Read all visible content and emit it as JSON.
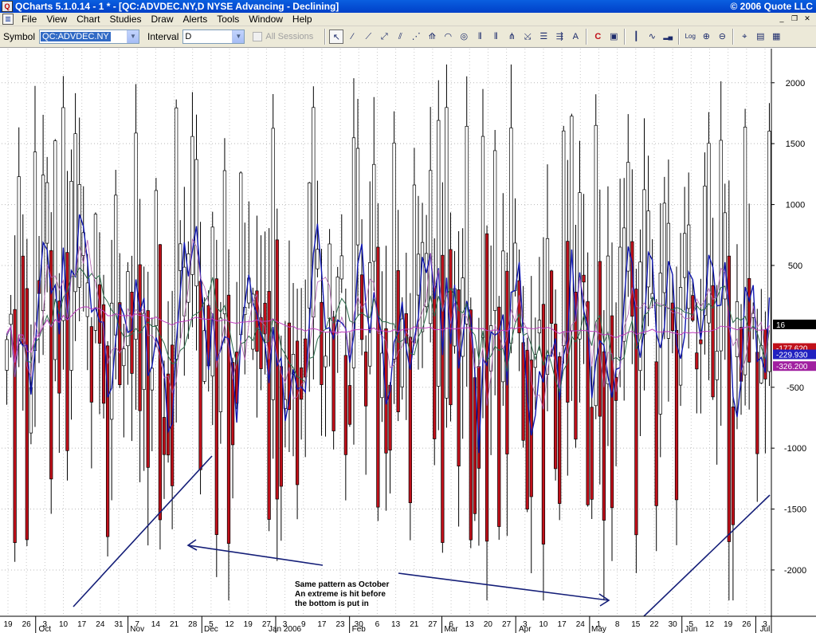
{
  "window": {
    "title": "QCharts 5.1.0.14 - 1 * - [QC:ADVDEC.NY,D NYSE Advancing - Declining]",
    "copyright": "© 2006 Quote LLC",
    "app_icon": "qcharts-logo-icon"
  },
  "menu": {
    "items": [
      "File",
      "View",
      "Chart",
      "Studies",
      "Draw",
      "Alerts",
      "Tools",
      "Window",
      "Help"
    ]
  },
  "toolbar": {
    "symbol_label": "Symbol",
    "symbol_value": "QC:ADVDEC.NY",
    "interval_label": "Interval",
    "interval_value": "D",
    "all_sessions_label": "All Sessions",
    "all_sessions_checked": false,
    "tools": [
      {
        "name": "pointer-icon",
        "glyph": "↖"
      },
      {
        "name": "trendline-icon",
        "glyph": "⁄"
      },
      {
        "name": "ray-icon",
        "glyph": "⟋"
      },
      {
        "name": "extended-line-icon",
        "glyph": "⤢"
      },
      {
        "name": "channel-icon",
        "glyph": "⫽"
      },
      {
        "name": "regression-icon",
        "glyph": "⋰"
      },
      {
        "name": "fan-icon",
        "glyph": "⟰"
      },
      {
        "name": "arc-icon",
        "glyph": "◠"
      },
      {
        "name": "ellipse-icon",
        "glyph": "◎"
      },
      {
        "name": "cycle-icon",
        "glyph": "⫴"
      },
      {
        "name": "fibonacci-time-icon",
        "glyph": "⦀"
      },
      {
        "name": "andrews-icon",
        "glyph": "⋔"
      },
      {
        "name": "gann-icon",
        "glyph": "⤩"
      },
      {
        "name": "retracement-icon",
        "glyph": "☰"
      },
      {
        "name": "speed-lines-icon",
        "glyph": "⇶"
      },
      {
        "name": "text-icon",
        "glyph": "A"
      },
      {
        "name": "color-icon",
        "glyph": "C"
      },
      {
        "name": "properties-icon",
        "glyph": "▣"
      },
      {
        "name": "bar-style-icon",
        "glyph": "┃"
      },
      {
        "name": "line-style-icon",
        "glyph": "∿"
      },
      {
        "name": "volume-icon",
        "glyph": "▂▄"
      },
      {
        "name": "log-scale-icon",
        "glyph": "Log"
      },
      {
        "name": "zoom-in-icon",
        "glyph": "⊕"
      },
      {
        "name": "zoom-out-icon",
        "glyph": "⊖"
      },
      {
        "name": "crosshair-icon",
        "glyph": "⌖"
      },
      {
        "name": "data-window-icon",
        "glyph": "▤"
      },
      {
        "name": "grid-icon",
        "glyph": "▦"
      }
    ]
  },
  "chart_data": {
    "type": "candlestick",
    "title": "",
    "symbol": "QC:ADVDEC.NY",
    "y_axis": {
      "position": "right",
      "ticks": [
        -2000,
        -1500,
        -1000,
        -500,
        500,
        1000,
        1500,
        2000
      ],
      "ylim": [
        -2380,
        2280
      ]
    },
    "x_axis": {
      "day_ticks": [
        "19",
        "26",
        "3",
        "10",
        "17",
        "24",
        "31",
        "7",
        "14",
        "21",
        "28",
        "5",
        "12",
        "19",
        "27",
        "3",
        "9",
        "17",
        "23",
        "30",
        "6",
        "13",
        "21",
        "27",
        "6",
        "13",
        "20",
        "27",
        "3",
        "10",
        "17",
        "24",
        "1",
        "8",
        "15",
        "22",
        "30",
        "5",
        "12",
        "19",
        "26",
        "3"
      ],
      "month_labels": [
        "Oct",
        "Nov",
        "Dec",
        "Jan 2006",
        "Feb",
        "Mar",
        "Apr",
        "May",
        "Jun",
        "Jul"
      ]
    },
    "price_labels": [
      {
        "text": "16",
        "value": 16,
        "bg": "#000000",
        "color": "#ffffff"
      },
      {
        "text": "-177.620",
        "value": -177.62,
        "bg": "#c0101a",
        "color": "#ffffff"
      },
      {
        "text": "-229.930",
        "value": -229.93,
        "bg": "#2020c0",
        "color": "#ffffff"
      },
      {
        "text": "-326.200",
        "value": -326.2,
        "bg": "#a020a0",
        "color": "#ffffff"
      }
    ],
    "annotations": {
      "text_lines": [
        "Same pattern as October",
        "An extreme is hit before",
        "the bottom is put in"
      ]
    },
    "series_colors": {
      "bullish_fill": "#ffffff",
      "bearish_fill": "#c0101a",
      "wick": "#000000",
      "ma_fast": "#1018b0",
      "ma_mid": "#2a6b4a",
      "ma_slow": "#b060b0",
      "ma_long": "#c040c0",
      "annotation": "#141e78"
    }
  }
}
